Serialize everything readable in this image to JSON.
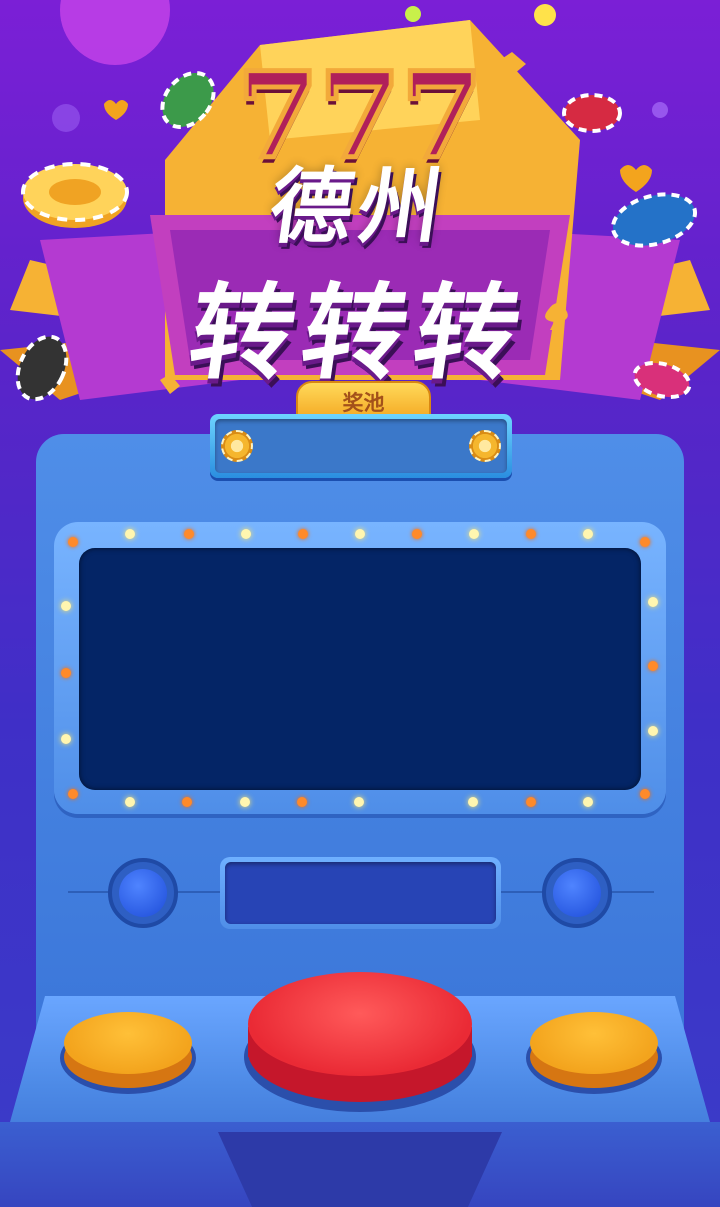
{
  "header": {
    "sevens": "777",
    "title_line1": "德州",
    "title_line2": "转转转"
  },
  "pool": {
    "label": "奖池",
    "amount": ""
  },
  "colors": {
    "background_top": "#7b1fd6",
    "background_bottom": "#3a3cc8",
    "cabinet": "#4f8ee8",
    "screen": "#042566",
    "spin_button": "#ea2a35",
    "side_buttons": "#f3a41d",
    "knobs": "#1d4cd8"
  },
  "icons": {
    "pool_left": "chip-coin-icon",
    "pool_right": "chip-coin-icon"
  }
}
